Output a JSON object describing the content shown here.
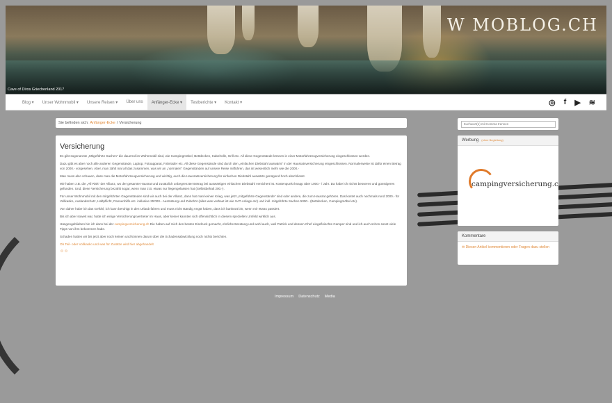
{
  "banner": {
    "logo": "W  MOBLOG.CH",
    "caption": "Cave of Diros Griechenland 2017"
  },
  "nav": {
    "items": [
      {
        "label": "Blog ▾"
      },
      {
        "label": "Unser Wohnmobil ▾"
      },
      {
        "label": "Unsere Reisen ▾"
      },
      {
        "label": "Über uns"
      },
      {
        "label": "Anfänger-Ecke ▾"
      },
      {
        "label": "Testberichte ▾"
      },
      {
        "label": "Kontakt ▾"
      }
    ],
    "socials": [
      "instagram-icon",
      "facebook-icon",
      "youtube-icon",
      "rss-icon"
    ]
  },
  "breadcrumb": {
    "prefix": "Sie befinden sich:",
    "parent": "Anfänger-Ecke",
    "separator": "/",
    "current": "Versicherung"
  },
  "article": {
    "title": "Versicherung",
    "paragraphs": [
      "Es gibt sogenannte „Mitgeführte Sachen“ die dauernd im Wohnmobil sind, wie Campingmöbel, Bettdecken, Kabelrolle, Grill etc. All diese Gegenstände können in einer Motorfahrzeugversicherung eingeschlossen werden.",
      "Dazu gibt es aber noch alle anderen Gegenstände, Laptop, Fotoapparat, Fahrräder etc. All diese Gegenstände sind durch den „einfachen Diebstahl auswärts“ in der Hausratsversicherung eingeschlossen. Normalerweise ist dafür einen Betrag von 2000.- vorgesehen. Aber, man zählt mal all das zusammen, was wir an „normalen“ Gegenständen auf unsere Reise mitführen, das ist wesentlich mehr wie die 2000.-",
      "Man muss also schauen, dass man die Motorfahrzeugversicherung und wichtig, auch die Hausratsversicherung für einfachen Diebstahl auswärts genügend hoch abschliesst.",
      "Wir haben z.B. die „All Risk“ der Allianz, wo der gesamte Hausrat und zusätzlich unbegrenzter Betrag bei auswärtigen einfachen Diebstahl versichert ist. Kostenpunkt knapp über 1000.- / Jahr. Da habe ich nichts besseres und günstigeres gefunden. Und, diese Versicherung bezahlt sogar, wenn man z.B. etwas nur liegengelassen hat (Selbstbehalt 200.-).",
      "Für unser Wohnmobil mit den mitgeführten Gegenständen sind wir auch bei der Allianz, dann hat man keinen Krieg, was jetzt „mitgeführte Gegenstände“ sind oder andere, die zum Hausrat gehören. Das kostet auch nochmals rund 2000.- für Vollkasko, Auslandschutz, Haftpflicht, Pannenhilfe etc. inklusive 25'000.- Ausrüstung und Zubehör (alles was verbaut ist wie SAT-Anlage etc) und inkl. mitgeführte Sachen 5000.- (Bettdecken, Campingmöbel etc).",
      "Von daher habe ich das Gefühl, ich kann beruhigt in den Urlaub fahren und muss nicht ständig Angst haben, dass ich bankrott bin, wenn mir etwas passiert.",
      "Bis ich aber soweit war, hatte ich einige Versicherungsvertreter im Haus, aber keiner kannten sich offensichtlich in diesem speziellen Umfeld wirklich aus."
    ],
    "p8_before": "Hängengeblieben bin ich dann bei der ",
    "p8_link": "campingversicherung.ch",
    "p8_after": " Die haben auf mich den besten Eindruck gemacht, ehrliche Beratung und wohl auch, weil Patrick und dessen Chef eingefleischte Camper sind und ich auch schon sonst viele Tipps von ihm bekommen habe.",
    "p9": "Schaden hatten wir bis jetzt aber noch keinen und können darum über die Schadensabwicklung noch nichts berichten.",
    "link_more": "Ob Teil- oder Vollkasko und was für Zusätze wird hier abgehandelt",
    "icons": "☺☺"
  },
  "footer": {
    "links": [
      "Impressum",
      "Datenschutz",
      "Media"
    ]
  },
  "sidebar": {
    "search_placeholder": "Suchwort(e) mit Komma trennen",
    "ad_title": "Werbung",
    "ad_note": "(ohne Begleitung)",
    "ad_text": "campingversicherung.ch",
    "comments_title": "Kommentare",
    "comments_link": "✉ Diesen Artikel kommentieren oder Fragen dazu stellen"
  }
}
